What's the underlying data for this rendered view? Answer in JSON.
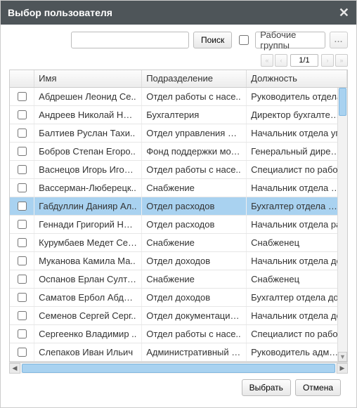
{
  "dialog": {
    "title": "Выбор пользователя"
  },
  "search": {
    "value": "",
    "button": "Поиск",
    "workgroups_label": "Рабочие группы",
    "more": "..."
  },
  "pager": {
    "page": "1/1"
  },
  "columns": {
    "check": "",
    "name": "Имя",
    "dept": "Подразделение",
    "pos": "Должность"
  },
  "rows": [
    {
      "name": "Абдрешен Леонид Се..",
      "dept": "Отдел работы с насе..",
      "pos": "Руководитель отдела",
      "selected": false
    },
    {
      "name": "Андреев Николай Ник..",
      "dept": "Бухгалтерия",
      "pos": "Директор бухгалтерии",
      "selected": false
    },
    {
      "name": "Балтиев Руслан Тахи..",
      "dept": "Отдел управления фи..",
      "pos": "Начальник отдела уп",
      "selected": false
    },
    {
      "name": "Бобров Степан Егоро..",
      "dept": "Фонд поддержки моло..",
      "pos": "Генеральный директо",
      "selected": false
    },
    {
      "name": "Васнецов Игорь Игоре..",
      "dept": "Отдел работы с насе..",
      "pos": "Специалист по работ",
      "selected": false
    },
    {
      "name": "Вассерман-Люберецк..",
      "dept": "Снабжение",
      "pos": "Начальник отдела сна",
      "selected": false
    },
    {
      "name": "Габдуллин Данияр Ал..",
      "dept": "Отдел расходов",
      "pos": "Бухгалтер отдела рас",
      "selected": true
    },
    {
      "name": "Геннади Григорий Ник..",
      "dept": "Отдел расходов",
      "pos": "Начальник отдела ра",
      "selected": false
    },
    {
      "name": "Курумбаев Медет Сер..",
      "dept": "Снабжение",
      "pos": "Снабженец",
      "selected": false
    },
    {
      "name": "Муканова Камила Ма..",
      "dept": "Отдел доходов",
      "pos": "Начальник отдела до",
      "selected": false
    },
    {
      "name": "Оспанов Ерлан Султа..",
      "dept": "Снабжение",
      "pos": "Снабженец",
      "selected": false
    },
    {
      "name": "Саматов Ербол Абдра..",
      "dept": "Отдел доходов",
      "pos": "Бухгалтер отдела до",
      "selected": false
    },
    {
      "name": "Семенов Сергей Серг..",
      "dept": "Отдел документации, ..",
      "pos": "Начальник отдела до",
      "selected": false
    },
    {
      "name": "Сергеенко Владимир ..",
      "dept": "Отдел работы с насе..",
      "pos": "Специалист по работ",
      "selected": false
    },
    {
      "name": "Слепаков Иван Ильич",
      "dept": "Административный от..",
      "pos": "Руководитель админи",
      "selected": false
    }
  ],
  "footer": {
    "select": "Выбрать",
    "cancel": "Отмена"
  }
}
